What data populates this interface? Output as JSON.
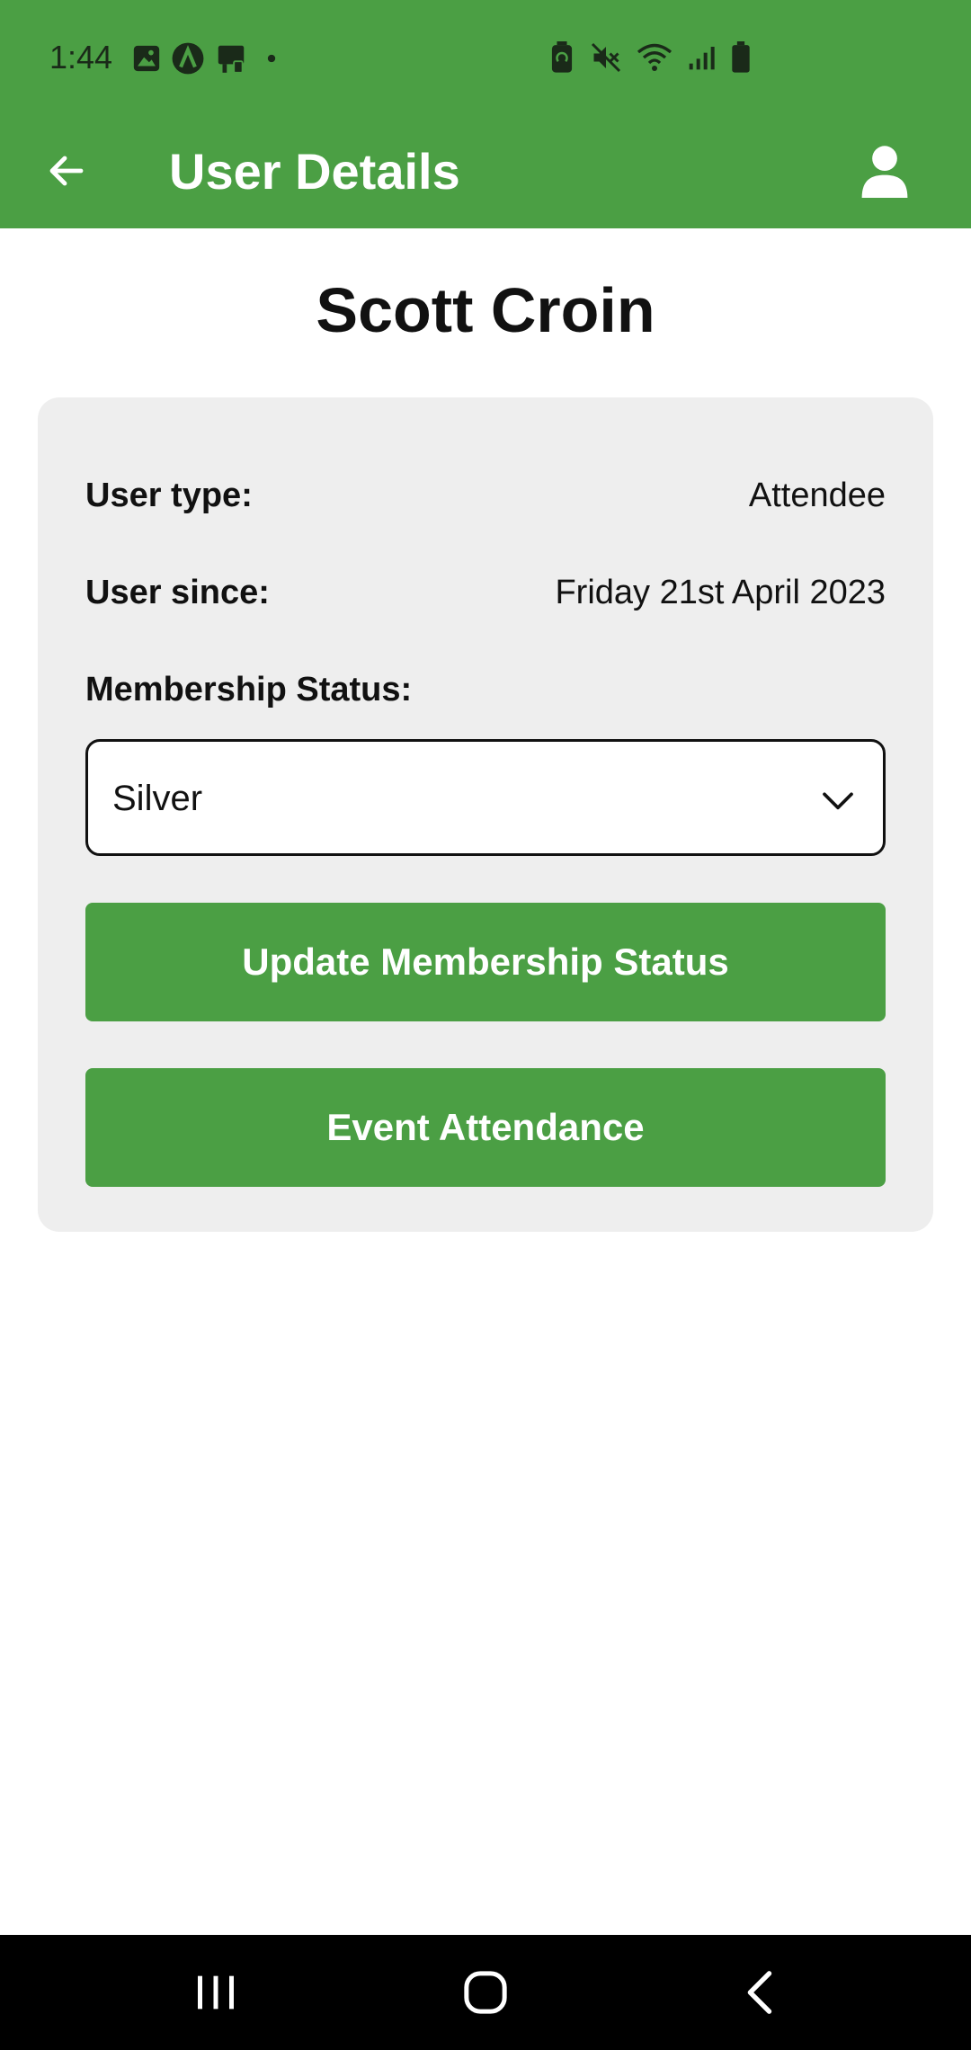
{
  "status_bar": {
    "time": "1:44",
    "left_icons": [
      "gallery-icon",
      "app-a-icon",
      "cast-icon",
      "notification-dot-icon"
    ],
    "right_icons": [
      "battery-saver-icon",
      "mute-icon",
      "wifi-icon",
      "signal-icon",
      "battery-icon"
    ]
  },
  "toolbar": {
    "title": "User Details",
    "back_icon": "arrow-left-icon",
    "profile_icon": "person-icon"
  },
  "user": {
    "name": "Scott Croin"
  },
  "details": {
    "user_type_label": "User type:",
    "user_type_value": "Attendee",
    "user_since_label": "User since:",
    "user_since_value": "Friday 21st April 2023",
    "membership_label": "Membership Status:"
  },
  "membership_select": {
    "selected": "Silver"
  },
  "buttons": {
    "update_label": "Update Membership Status",
    "event_label": "Event Attendance"
  },
  "nav_bar": {
    "icons": [
      "recents-icon",
      "home-icon",
      "back-icon"
    ]
  },
  "colors": {
    "primary": "#4b9f44",
    "card_background": "#eeeeee",
    "nav_background": "#000000"
  }
}
